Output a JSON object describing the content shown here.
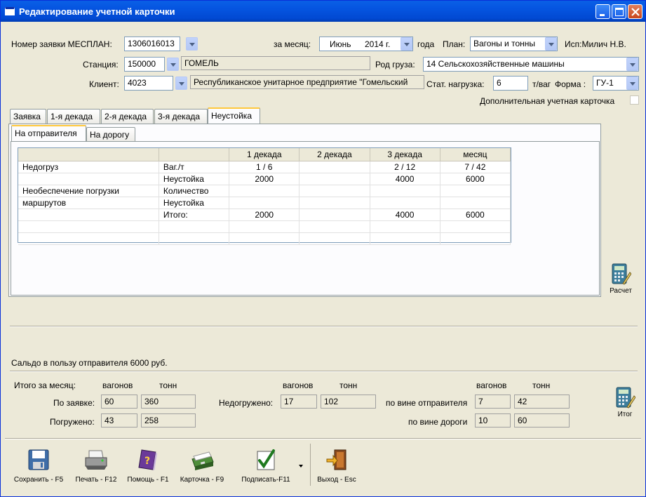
{
  "window": {
    "title": "Редактирование учетной карточки"
  },
  "form": {
    "request_label": "Номер заявки МЕСПЛАН:",
    "request_value": "1306016013",
    "month_label": "за месяц:",
    "month_value": "Июнь",
    "year_value": "2014 г.",
    "year_suffix": "года",
    "plan_label": "План:",
    "plan_value": "Вагоны и тонны",
    "executor": "Исп:Милич Н.В.",
    "station_label": "Станция:",
    "station_code": "150000",
    "station_name": "ГОМЕЛЬ",
    "cargo_label": "Род груза:",
    "cargo_value": "14 Сельскохозяйственные машины",
    "client_label": "Клиент:",
    "client_code": "4023",
    "client_name": "Республиканское унитарное предприятие \"Гомельский",
    "load_label": "Стат. нагрузка:",
    "load_value": "6",
    "load_unit": "т/ваг",
    "form_label": "Форма :",
    "form_value": "ГУ-1",
    "extra_card_label": "Дополнительная учетная карточка"
  },
  "tabs": [
    "Заявка",
    "1-я декада",
    "2-я декада",
    "3-я декада",
    "Неустойка"
  ],
  "subtabs": [
    "На отправителя",
    "На дорогу"
  ],
  "grid": {
    "headers": [
      "",
      "",
      "1 декада",
      "2 декада",
      "3 декада",
      "месяц"
    ],
    "rows": [
      [
        "Недогруз",
        "Ваг./т",
        "1 / 6",
        "",
        "2 / 12",
        "7 / 42"
      ],
      [
        "",
        "Неустойка",
        "2000",
        "",
        "4000",
        "6000"
      ],
      [
        "Необеспечение погрузки",
        "Количество",
        "",
        "",
        "",
        ""
      ],
      [
        "маршрутов",
        "Неустойка",
        "",
        "",
        "",
        ""
      ],
      [
        "",
        "Итого:",
        "2000",
        "",
        "4000",
        "6000"
      ],
      [
        "",
        "",
        "",
        "",
        "",
        ""
      ],
      [
        "",
        "",
        "",
        "",
        "",
        ""
      ]
    ]
  },
  "calc_button": "Расчет",
  "balance_text": "Сальдо в пользу отправителя 6000 руб.",
  "totals": {
    "title": "Итого за месяц:",
    "wagons": "вагонов",
    "tons": "тонн",
    "by_request_label": "По заявке:",
    "by_request_wagons": "60",
    "by_request_tons": "360",
    "loaded_label": "Погружено:",
    "loaded_wagons": "43",
    "loaded_tons": "258",
    "underloaded_label": "Недогружено:",
    "underloaded_wagons": "17",
    "underloaded_tons": "102",
    "sender_fault_label": "по вине отправителя",
    "sender_fault_wagons": "7",
    "sender_fault_tons": "42",
    "road_fault_label": "по вине дороги",
    "road_fault_wagons": "10",
    "road_fault_tons": "60"
  },
  "total_button": "Итог",
  "toolbar": {
    "save": "Сохранить - F5",
    "print": "Печать - F12",
    "help": "Помощь - F1",
    "card": "Карточка - F9",
    "sign": "Подписать-F11",
    "exit": "Выход - Esc"
  },
  "icons": [
    "window-icon",
    "minimize-icon",
    "maximize-icon",
    "close-icon",
    "calculator-icon",
    "floppy-icon",
    "printer-icon",
    "help-book-icon",
    "card-file-icon",
    "checkmark-icon",
    "exit-door-icon"
  ]
}
